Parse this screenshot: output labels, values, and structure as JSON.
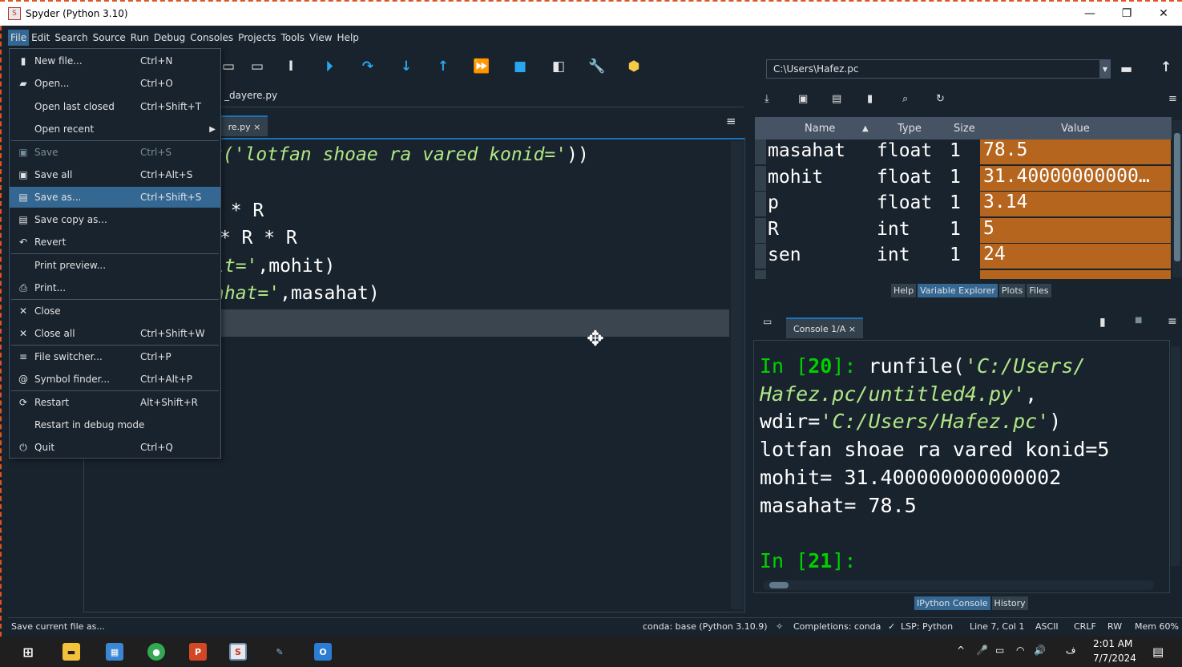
{
  "window": {
    "title": "Spyder (Python 3.10)",
    "app_icon": "spyder-icon",
    "minimize": "—",
    "restore": "❐",
    "close": "✕"
  },
  "menubar": [
    "File",
    "Edit",
    "Search",
    "Source",
    "Run",
    "Debug",
    "Consoles",
    "Projects",
    "Tools",
    "View",
    "Help"
  ],
  "file_menu": {
    "items": [
      {
        "label": "New file...",
        "shortcut": "Ctrl+N",
        "icon": "file-icon"
      },
      {
        "label": "Open...",
        "shortcut": "Ctrl+O",
        "icon": "folder-open-icon"
      },
      {
        "label": "Open last closed",
        "shortcut": "Ctrl+Shift+T",
        "icon": ""
      },
      {
        "label": "Open recent",
        "shortcut": "",
        "icon": ""
      },
      {
        "label": "Save",
        "shortcut": "Ctrl+S",
        "icon": "save-icon"
      },
      {
        "label": "Save all",
        "shortcut": "Ctrl+Alt+S",
        "icon": "save-all-icon"
      },
      {
        "label": "Save as...",
        "shortcut": "Ctrl+Shift+S",
        "icon": "save-as-icon"
      },
      {
        "label": "Save copy as...",
        "shortcut": "",
        "icon": "save-copy-icon"
      },
      {
        "label": "Revert",
        "shortcut": "",
        "icon": "revert-icon"
      },
      {
        "label": "Print preview...",
        "shortcut": "",
        "icon": ""
      },
      {
        "label": "Print...",
        "shortcut": "",
        "icon": "print-icon"
      },
      {
        "label": "Close",
        "shortcut": "",
        "icon": "close-icon"
      },
      {
        "label": "Close all",
        "shortcut": "Ctrl+Shift+W",
        "icon": "close-all-icon"
      },
      {
        "label": "File switcher...",
        "shortcut": "Ctrl+P",
        "icon": "file-switcher-icon"
      },
      {
        "label": "Symbol finder...",
        "shortcut": "Ctrl+Alt+P",
        "icon": "symbol-finder-icon"
      },
      {
        "label": "Restart",
        "shortcut": "Alt+Shift+R",
        "icon": "restart-icon"
      },
      {
        "label": "Restart in debug mode",
        "shortcut": "",
        "icon": ""
      },
      {
        "label": "Quit",
        "shortcut": "Ctrl+Q",
        "icon": "power-icon"
      }
    ]
  },
  "editor": {
    "filename": "_dayere.py",
    "tab_label": "re.py",
    "tab_close": "×",
    "menu_glyph": "≡",
    "code": [
      {
        "pre": "t(",
        "str": "'lotfan shoae ra vared konid='",
        "post": "))"
      },
      {
        "pre": "",
        "str": "",
        "post": ""
      },
      {
        "pre": "p * R",
        "str": "",
        "post": ""
      },
      {
        "pre": " * R * R",
        "str": "",
        "post": ""
      },
      {
        "pre": "",
        "str": "it='",
        "post": ",mohit)"
      },
      {
        "pre": "",
        "str": "ahat='",
        "post": ",masahat)"
      }
    ]
  },
  "path": {
    "value": "C:\\Users\\Hafez.pc"
  },
  "variable_explorer": {
    "columns": [
      "Name",
      "Type",
      "Size",
      "Value"
    ],
    "rows": [
      {
        "name": "masahat",
        "type": "float",
        "size": "1",
        "value": "78.5"
      },
      {
        "name": "mohit",
        "type": "float",
        "size": "1",
        "value": "31.40000000000…"
      },
      {
        "name": "p",
        "type": "float",
        "size": "1",
        "value": "3.14"
      },
      {
        "name": "R",
        "type": "int",
        "size": "1",
        "value": "5"
      },
      {
        "name": "sen",
        "type": "int",
        "size": "1",
        "value": "24"
      }
    ],
    "tabs": [
      "Help",
      "Variable Explorer",
      "Plots",
      "Files"
    ]
  },
  "console": {
    "tab_label": "Console 1/A",
    "tab_close": "×",
    "lines": [
      {
        "prompt": "In [",
        "num": "20",
        "end": "]: ",
        "text": "runfile(",
        "str": "'C:/Users/",
        "post": ""
      },
      {
        "prompt": "",
        "num": "",
        "end": "",
        "text": "",
        "str": "Hafez.pc/untitled4.py'",
        "post": ","
      },
      {
        "prompt": "",
        "num": "",
        "end": "",
        "text": "wdir=",
        "str": "'C:/Users/Hafez.pc'",
        "post": ")"
      },
      {
        "prompt": "",
        "num": "",
        "end": "",
        "text": "lotfan shoae ra vared konid=5",
        "str": "",
        "post": ""
      },
      {
        "prompt": "",
        "num": "",
        "end": "",
        "text": "mohit= 31.400000000000002",
        "str": "",
        "post": ""
      },
      {
        "prompt": "",
        "num": "",
        "end": "",
        "text": "masahat= 78.5",
        "str": "",
        "post": ""
      },
      {
        "prompt": "In [",
        "num": "21",
        "end": "]:",
        "text": "",
        "str": "",
        "post": ""
      }
    ],
    "tabs": [
      "IPython Console",
      "History"
    ]
  },
  "statusbar": {
    "message": "Save current file as...",
    "conda": "conda: base (Python 3.10.9)",
    "completions": "Completions: conda",
    "lsp": "LSP: Python",
    "position": "Line 7, Col 1",
    "encoding": "ASCII",
    "eol": "CRLF",
    "rw": "RW",
    "mem": "Mem 60%"
  },
  "taskbar": {
    "time": "2:01 AM",
    "date": "7/7/2024",
    "lang": "ف"
  },
  "colors": {
    "background": "#19232d",
    "accent": "#346792",
    "value_cell": "#b5651d",
    "string": "#b0e686",
    "prompt": "#00d000",
    "toolbar_blue": "#2aa6f1"
  }
}
